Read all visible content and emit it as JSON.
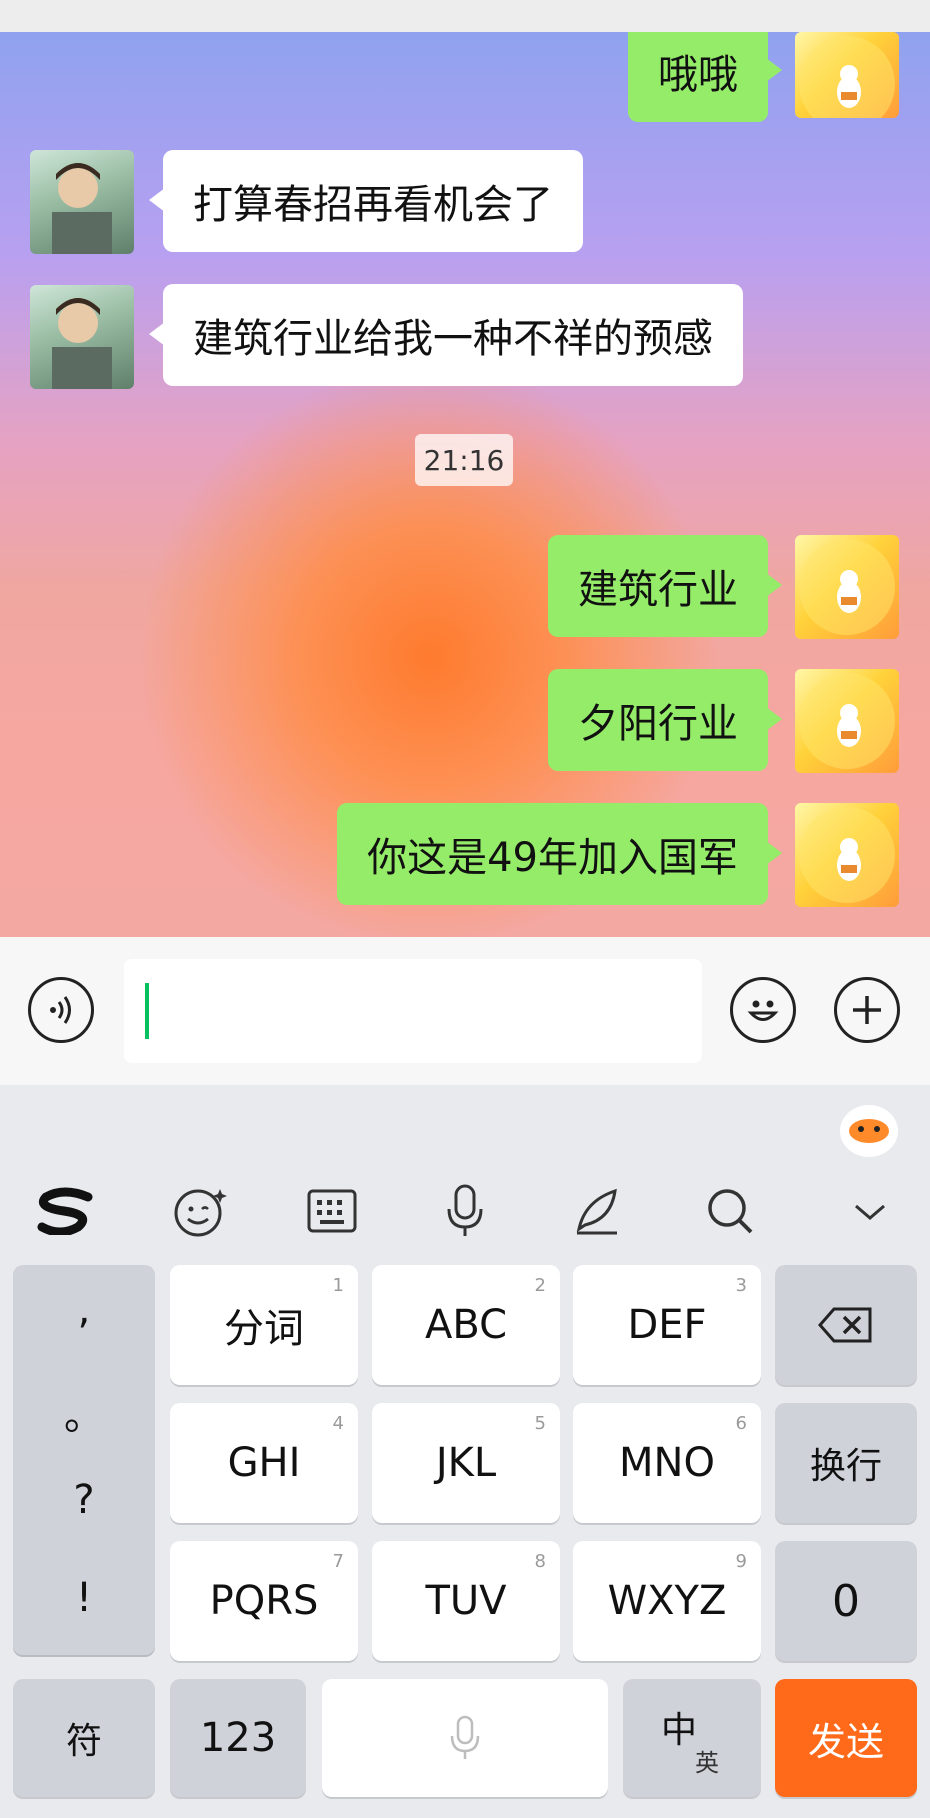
{
  "messages": [
    {
      "side": "me",
      "text": "哦哦"
    },
    {
      "side": "friend",
      "text": "打算春招再看机会了"
    },
    {
      "side": "friend",
      "text": "建筑行业给我一种不祥的预感"
    },
    {
      "side": "me",
      "text": "建筑行业"
    },
    {
      "side": "me",
      "text": "夕阳行业"
    },
    {
      "side": "me",
      "text": "你这是49年加入国军"
    }
  ],
  "timestamp": "21:16",
  "input": {
    "value": ""
  },
  "keyboard": {
    "keys": {
      "k1": {
        "label": "分词",
        "num": "1"
      },
      "k2": {
        "label": "ABC",
        "num": "2"
      },
      "k3": {
        "label": "DEF",
        "num": "3"
      },
      "k4": {
        "label": "GHI",
        "num": "4"
      },
      "k5": {
        "label": "JKL",
        "num": "5"
      },
      "k6": {
        "label": "MNO",
        "num": "6"
      },
      "k7": {
        "label": "PQRS",
        "num": "7"
      },
      "k8": {
        "label": "TUV",
        "num": "8"
      },
      "k9": {
        "label": "WXYZ",
        "num": "9"
      }
    },
    "punct": [
      ",",
      "。",
      "?",
      "!"
    ],
    "newline": "换行",
    "zero": "0",
    "symbols": "符",
    "numbers": "123",
    "lang_main": "中",
    "lang_alt": "英",
    "send": "发送"
  },
  "colors": {
    "me_bubble": "#95ec69",
    "friend_bubble": "#ffffff",
    "send": "#ff6a1a"
  },
  "icons": [
    "voice-icon",
    "emoji-icon",
    "plus-icon",
    "sogou-logo-icon",
    "face-icon",
    "keyboard-icon",
    "mic-icon",
    "pen-icon",
    "search-icon",
    "chevron-down-icon",
    "backspace-icon"
  ]
}
